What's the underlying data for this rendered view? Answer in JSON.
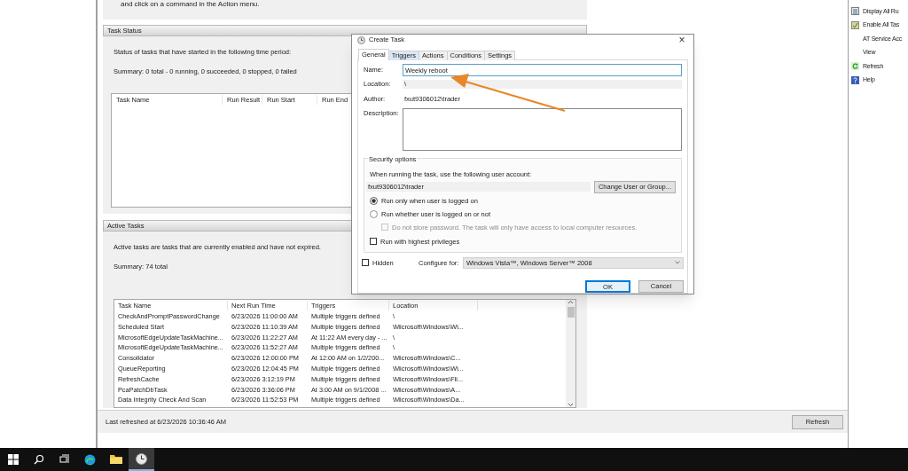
{
  "intro_text": "and click on a command in the Action menu.",
  "task_status": {
    "title": "Task Status",
    "description": "Status of tasks that have started in the following time period:",
    "summary": "Summary: 0 total - 0 running, 0 succeeded, 0 stopped, 0 failed",
    "columns": [
      "Task Name",
      "Run Result",
      "Run Start",
      "Run End"
    ]
  },
  "active_tasks": {
    "title": "Active Tasks",
    "description": "Active tasks are tasks that are currently enabled and have not expired.",
    "summary": "Summary: 74 total",
    "columns": [
      "Task Name",
      "Next Run Time",
      "Triggers",
      "Location"
    ],
    "rows": [
      [
        "CheckAndPromptPasswordChange",
        "6/23/2026 11:00:00 AM",
        "Multiple triggers defined",
        "\\"
      ],
      [
        "Scheduled Start",
        "6/23/2026 11:10:39 AM",
        "Multiple triggers defined",
        "\\Microsoft\\Windows\\Wi..."
      ],
      [
        "MicrosoftEdgeUpdateTaskMachine...",
        "6/23/2026 11:22:27 AM",
        "At 11:22 AM every day - ...",
        "\\"
      ],
      [
        "MicrosoftEdgeUpdateTaskMachine...",
        "6/23/2026 11:52:27 AM",
        "Multiple triggers defined",
        "\\"
      ],
      [
        "Consolidator",
        "6/23/2026 12:00:00 PM",
        "At 12:00 AM on 1/2/200...",
        "\\Microsoft\\Windows\\C..."
      ],
      [
        "QueueReporting",
        "6/23/2026 12:04:45 PM",
        "Multiple triggers defined",
        "\\Microsoft\\Windows\\Wi..."
      ],
      [
        "RefreshCache",
        "6/23/2026 3:12:19 PM",
        "Multiple triggers defined",
        "\\Microsoft\\Windows\\Fli..."
      ],
      [
        "PcaPatchDbTask",
        "6/23/2026 3:36:06 PM",
        "At 3:00 AM on 9/1/2008 ...",
        "\\Microsoft\\Windows\\A..."
      ],
      [
        "Data Integrity Check And Scan",
        "6/23/2026 11:52:53 PM",
        "Multiple triggers defined",
        "\\Microsoft\\Windows\\Da..."
      ]
    ]
  },
  "status_bar": {
    "text": "Last refreshed at 6/23/2026 10:36:46 AM",
    "button": "Refresh"
  },
  "actions_pane": {
    "items": [
      {
        "label": "Display All Ru",
        "kind": "list"
      },
      {
        "label": "Enable All Tas",
        "kind": "enable"
      },
      {
        "label": "AT Service Acc",
        "kind": "plain"
      },
      {
        "label": "View",
        "kind": "plain"
      },
      {
        "label": "Refresh",
        "kind": "refresh"
      },
      {
        "label": "Help",
        "kind": "help"
      }
    ]
  },
  "dialog": {
    "title": "Create Task",
    "close": "×",
    "tabs": [
      {
        "label": "General",
        "selected": true
      },
      {
        "label": "Triggers",
        "selected": false
      },
      {
        "label": "Actions",
        "selected": false
      },
      {
        "label": "Conditions",
        "selected": false
      },
      {
        "label": "Settings",
        "selected": false
      }
    ],
    "name_label": "Name:",
    "name_value": "Weekly reboot",
    "location_label": "Location:",
    "location_value": "\\",
    "author_label": "Author:",
    "author_value": "fxut9306012\\trader",
    "description_label": "Description:",
    "security": {
      "title": "Security options",
      "account_prompt": "When running the task, use the following user account:",
      "account": "fxut9306012\\trader",
      "change_button": "Change User or Group...",
      "radios": [
        {
          "label": "Run only when user is logged on",
          "selected": true
        },
        {
          "label": "Run whether user is logged on or not",
          "selected": false
        }
      ],
      "no_password": {
        "label": "Do not store password.  The task will only have access to local computer resources.",
        "checked": false,
        "disabled": true
      },
      "highest": {
        "label": "Run with highest privileges",
        "checked": false
      }
    },
    "hidden": {
      "label": "Hidden",
      "checked": false
    },
    "configure_label": "Configure for:",
    "configure_value": "Windows Vista™, Windows Server™ 2008",
    "buttons": [
      {
        "label": "OK",
        "default": true
      },
      {
        "label": "Cancel",
        "default": false
      }
    ]
  }
}
